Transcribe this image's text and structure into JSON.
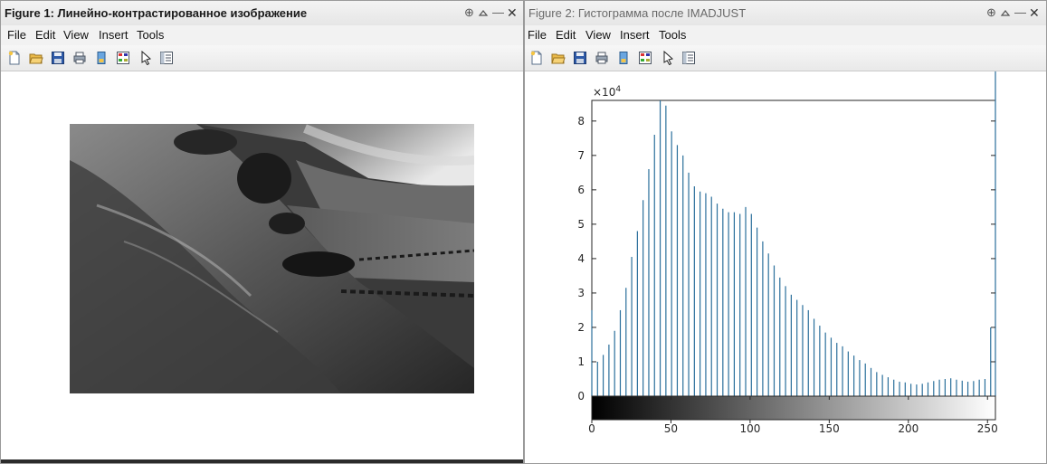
{
  "figure1": {
    "title": "Figure 1: Линейно-контрастированное изображение",
    "menu": [
      "File",
      "Edit",
      "View",
      "Insert",
      "Tools"
    ]
  },
  "figure2": {
    "title": "Figure 2: Гистограмма после IMADJUST",
    "menu": [
      "File",
      "Edit",
      "View",
      "Insert",
      "Tools"
    ]
  },
  "window_controls": {
    "pin": "⊕",
    "minimize": "—",
    "close": "✕"
  },
  "toolbar_icons": [
    "new-figure-icon",
    "open-file-icon",
    "save-icon",
    "print-icon",
    "link-plot-icon",
    "insert-colorbar-icon",
    "pointer-icon",
    "property-editor-icon"
  ],
  "chart_data": {
    "type": "bar",
    "title": "",
    "xlabel": "",
    "ylabel": "",
    "y_exponent_label": "×10",
    "y_exponent": "4",
    "xlim": [
      0,
      255
    ],
    "ylim": [
      0,
      8.6
    ],
    "xticks": [
      0,
      50,
      100,
      150,
      200,
      250
    ],
    "yticks": [
      0,
      1,
      2,
      3,
      4,
      5,
      6,
      7,
      8
    ],
    "bar_color": "#2a6f9b",
    "colorbar": "grayscale 0→255",
    "x": [
      0,
      3.6,
      7.2,
      10.8,
      14.4,
      18,
      21.6,
      25.2,
      28.8,
      32.4,
      36,
      39.6,
      43.2,
      46.8,
      50.4,
      54,
      57.6,
      61.2,
      64.8,
      68.4,
      72,
      75.6,
      79.2,
      82.8,
      86.4,
      90,
      93.6,
      97.2,
      100.8,
      104.4,
      108,
      111.6,
      115.2,
      118.8,
      122.4,
      126,
      129.6,
      133.2,
      136.8,
      140.4,
      144,
      147.6,
      151.2,
      154.8,
      158.4,
      162,
      165.6,
      169.2,
      172.8,
      176.4,
      180,
      183.6,
      187.2,
      190.8,
      194.4,
      198,
      201.6,
      205.2,
      208.8,
      212.4,
      216,
      219.6,
      223.2,
      226.8,
      230.4,
      234,
      237.6,
      241.2,
      244.8,
      248.4,
      252,
      255
    ],
    "values": [
      2.5,
      1.0,
      1.2,
      1.5,
      1.9,
      2.5,
      3.15,
      4.05,
      4.8,
      5.7,
      6.6,
      7.6,
      8.6,
      8.45,
      7.7,
      7.3,
      7.0,
      6.5,
      6.1,
      5.95,
      5.9,
      5.8,
      5.6,
      5.45,
      5.35,
      5.35,
      5.3,
      5.5,
      5.3,
      4.9,
      4.5,
      4.15,
      3.8,
      3.45,
      3.2,
      2.95,
      2.8,
      2.65,
      2.5,
      2.25,
      2.05,
      1.85,
      1.7,
      1.55,
      1.45,
      1.3,
      1.18,
      1.05,
      0.95,
      0.82,
      0.7,
      0.62,
      0.55,
      0.48,
      0.42,
      0.4,
      0.36,
      0.34,
      0.36,
      0.4,
      0.44,
      0.48,
      0.5,
      0.52,
      0.48,
      0.45,
      0.42,
      0.44,
      0.48,
      0.5,
      2.0
    ]
  }
}
